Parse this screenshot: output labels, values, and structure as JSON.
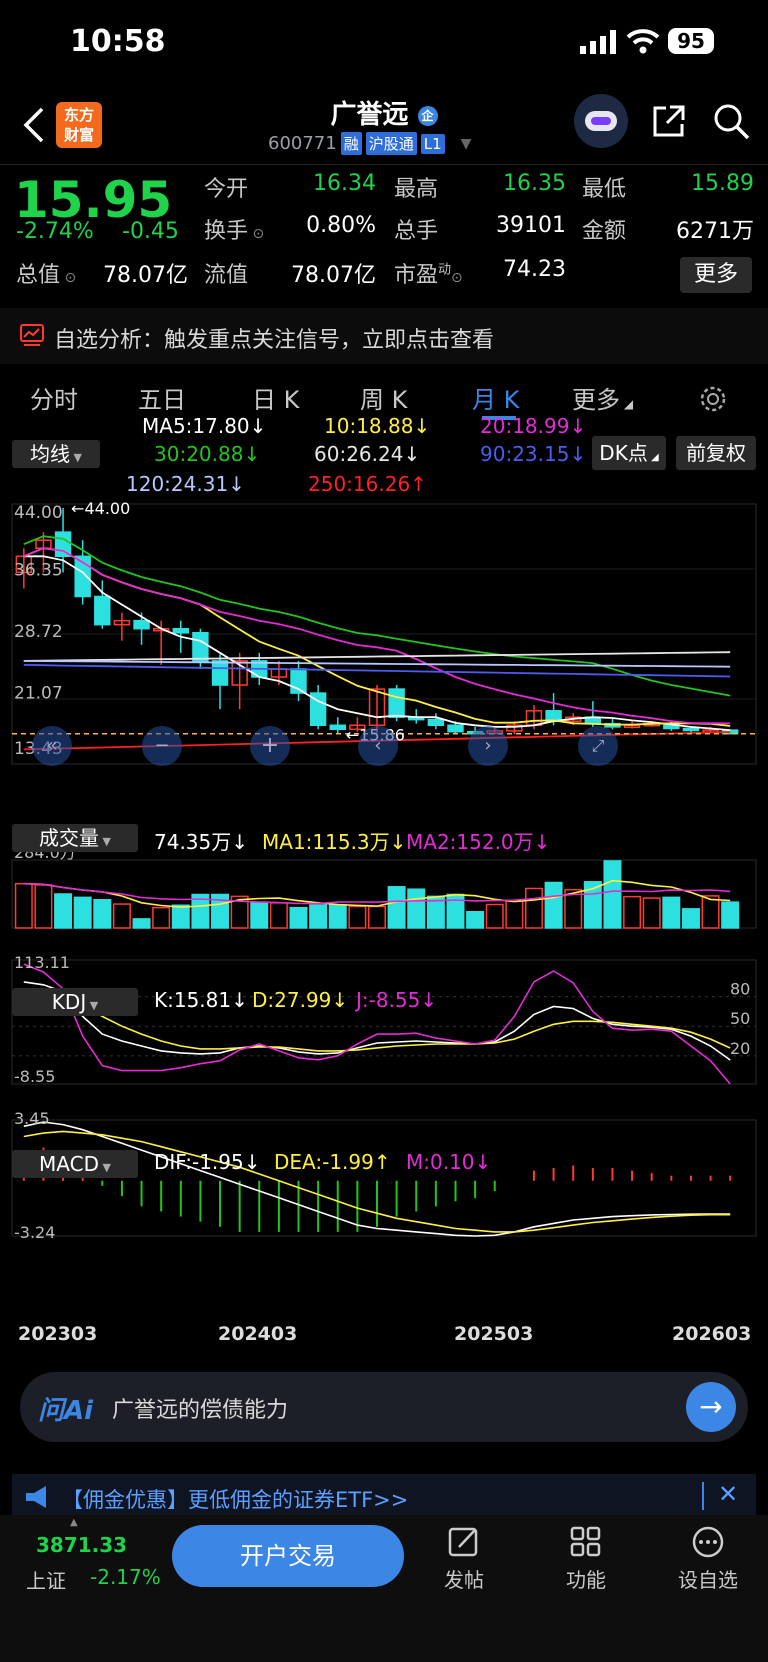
{
  "status_bar": {
    "time": "10:58",
    "battery": "95"
  },
  "header": {
    "title": "广誉远",
    "title_badge": "企",
    "logo_line1": "东方",
    "logo_line2": "财富",
    "code": "600771",
    "tags": [
      "融",
      "沪股通",
      "L1"
    ]
  },
  "quote": {
    "price": "15.95",
    "change_pct": "-2.74%",
    "change": "-0.45",
    "fields": [
      {
        "label": "今开",
        "value": "16.34",
        "color": "#1fd34a"
      },
      {
        "label": "最高",
        "value": "16.35",
        "color": "#1fd34a"
      },
      {
        "label": "最低",
        "value": "15.89",
        "color": "#1fd34a"
      },
      {
        "label": "换手",
        "value": "0.80%",
        "color": "#ffffff"
      },
      {
        "label": "总手",
        "value": "39101",
        "color": "#ffffff"
      },
      {
        "label": "金额",
        "value": "6271万",
        "color": "#ffffff"
      },
      {
        "label": "流值",
        "value": "78.07亿",
        "color": "#ffffff"
      },
      {
        "label": "市盈",
        "value": "74.23",
        "color": "#ffffff"
      }
    ],
    "total_value_label": "总值",
    "total_value": "78.07亿",
    "pe_sup": "动",
    "more_label": "更多"
  },
  "alert": {
    "text": "自选分析：触发重点关注信号，立即点击查看"
  },
  "tabs": {
    "items": [
      "分时",
      "五日",
      "日 K",
      "周 K",
      "月 K",
      "更多"
    ],
    "active": "月 K"
  },
  "chart_controls": {
    "ma_select": "均线",
    "dk_label": "DK点",
    "fq_label": "前复权",
    "vol_select": "成交量",
    "kdj_select": "KDJ",
    "macd_select": "MACD"
  },
  "colors": {
    "up": "#ff3b30",
    "down": "#2de0e0",
    "ma5": "#ffffff",
    "ma10": "#ffef3f",
    "ma20": "#e52bd6",
    "ma30": "#23c41d",
    "ma60": "#e6e6e6",
    "ma90": "#4b5cf0",
    "ma120": "#b7c7ff",
    "ma250": "#ff2020",
    "accent": "#3c86e6"
  },
  "ma_legend": [
    {
      "text": "MA5:17.80",
      "arrow": "↓",
      "color": "#ffffff"
    },
    {
      "text": "10:18.88",
      "arrow": "↓",
      "color": "#ffef3f"
    },
    {
      "text": "20:18.99",
      "arrow": "↓",
      "color": "#e52bd6"
    },
    {
      "text": "30:20.88",
      "arrow": "↓",
      "color": "#23c41d"
    },
    {
      "text": "60:26.24",
      "arrow": "↓",
      "color": "#e6e6e6"
    },
    {
      "text": "90:23.15",
      "arrow": "↓",
      "color": "#4b5cf0"
    },
    {
      "text": "120:24.31",
      "arrow": "↓",
      "color": "#b7c7ff"
    },
    {
      "text": "250:16.26",
      "arrow": "↑",
      "color": "#ff2020"
    }
  ],
  "vol_legend": [
    {
      "text": "74.35万",
      "arrow": "↓",
      "color": "#ffffff"
    },
    {
      "text": "MA1:115.3万",
      "arrow": "↓",
      "color": "#ffef3f"
    },
    {
      "text": "MA2:152.0万",
      "arrow": "↓",
      "color": "#e52bd6"
    }
  ],
  "kdj_legend": [
    {
      "text": "K:15.81",
      "arrow": "↓",
      "color": "#ffffff"
    },
    {
      "text": "D:27.99",
      "arrow": "↓",
      "color": "#ffef3f"
    },
    {
      "text": "J:-8.55",
      "arrow": "↓",
      "color": "#e52bd6"
    }
  ],
  "macd_legend": [
    {
      "text": "DIF:-1.95",
      "arrow": "↓",
      "color": "#ffffff"
    },
    {
      "text": "DEA:-1.99",
      "arrow": "↑",
      "color": "#ffef3f"
    },
    {
      "text": "M:0.10",
      "arrow": "↓",
      "color": "#e52bd6"
    }
  ],
  "chart_data": {
    "type": "candlestick",
    "price_axis": [
      "44.00",
      "36.35",
      "28.72",
      "21.07",
      "13.43"
    ],
    "ylim": [
      13.43,
      44.0
    ],
    "max_marker": "44.00",
    "min_marker": "15.86",
    "vol_axis_top": "284.0万",
    "vol_max": 284.0,
    "kdj_axis": {
      "top": "113.11",
      "bottom": "-8.55",
      "levels": [
        "80",
        "50",
        "20"
      ]
    },
    "kdj_range": [
      -8.55,
      113.11
    ],
    "macd_axis": {
      "top": "3.45",
      "bottom": "-3.24"
    },
    "macd_range": [
      -3.24,
      3.45
    ],
    "x_labels": [
      "202303",
      "202403",
      "202503",
      "202603"
    ],
    "candles": [
      [
        36,
        38,
        39,
        34
      ],
      [
        39,
        40,
        41,
        36
      ],
      [
        41,
        38,
        44,
        36
      ],
      [
        38,
        33,
        40,
        32
      ],
      [
        33,
        29.5,
        35,
        29
      ],
      [
        29.5,
        30,
        31,
        27.5
      ],
      [
        30,
        29,
        31,
        27
      ],
      [
        29,
        29,
        30,
        24.5
      ],
      [
        29,
        28.5,
        30,
        26
      ],
      [
        28.5,
        25,
        29,
        24
      ],
      [
        25,
        22,
        26,
        19
      ],
      [
        22,
        25,
        26,
        19
      ],
      [
        25,
        23,
        26,
        22
      ],
      [
        23,
        24,
        25,
        22
      ],
      [
        24,
        21,
        25,
        20
      ],
      [
        21,
        17,
        22,
        16.5
      ],
      [
        17,
        16.5,
        18,
        16
      ],
      [
        16.5,
        17,
        18,
        16.2
      ],
      [
        17,
        21.5,
        22,
        16
      ],
      [
        21.5,
        18,
        22,
        17.5
      ],
      [
        18,
        17.7,
        19,
        17.2
      ],
      [
        17.7,
        17,
        18.5,
        16.5
      ],
      [
        17,
        16.2,
        17.5,
        15.9
      ],
      [
        16.2,
        16,
        16.8,
        15.9
      ],
      [
        16,
        16.3,
        16.8,
        15.86
      ],
      [
        16.3,
        17,
        17.5,
        15.9
      ],
      [
        17,
        18.8,
        19.5,
        16.5
      ],
      [
        18.8,
        17.5,
        21,
        17
      ],
      [
        17.5,
        18,
        18.5,
        17
      ],
      [
        18,
        17.2,
        20,
        16.8
      ],
      [
        17.2,
        16.8,
        17.8,
        16.5
      ],
      [
        16.8,
        17,
        17.5,
        16.6
      ],
      [
        17,
        17.2,
        17.5,
        16.8
      ],
      [
        17.2,
        16.6,
        17.5,
        16.3
      ],
      [
        16.6,
        16.4,
        16.9,
        16.1
      ],
      [
        16.4,
        16.4,
        16.8,
        16.2
      ],
      [
        16.4,
        15.95,
        16.4,
        15.89
      ]
    ],
    "volume": [
      185,
      180,
      142,
      128,
      118,
      100,
      38,
      85,
      95,
      140,
      140,
      132,
      108,
      105,
      85,
      96,
      96,
      90,
      90,
      172,
      162,
      132,
      140,
      68,
      98,
      113,
      165,
      190,
      160,
      193,
      280,
      131,
      125,
      128,
      80,
      134,
      108
    ],
    "ma5_close": [
      38,
      38,
      37.5,
      36,
      33.5,
      32,
      30.5,
      29,
      28,
      27.5,
      26,
      24.5,
      23,
      22.5,
      21.5,
      20,
      19,
      18.5,
      18,
      18.2,
      18,
      18,
      17.3,
      17,
      16.8,
      16.8,
      17,
      17.5,
      17.8,
      18,
      17.9,
      17.6,
      17.4,
      17.1,
      16.8,
      16.6,
      16.4
    ],
    "kdj_k": [
      95,
      92,
      85,
      60,
      42,
      35,
      30,
      25,
      23,
      22,
      23,
      28,
      30,
      28,
      24,
      22,
      23,
      28,
      33,
      34,
      35,
      34,
      33,
      32,
      34,
      45,
      62,
      70,
      68,
      58,
      52,
      50,
      49,
      47,
      40,
      30,
      15.81
    ],
    "kdj_d": [
      80,
      85,
      84,
      72,
      60,
      50,
      42,
      35,
      30,
      27,
      27,
      28,
      29,
      29,
      27,
      25,
      25,
      26,
      28,
      30,
      31,
      32,
      32,
      32,
      33,
      37,
      45,
      52,
      55,
      55,
      54,
      52,
      50,
      48,
      44,
      37,
      27.99
    ],
    "kdj_j": [
      113,
      105,
      88,
      40,
      10,
      5,
      5,
      5,
      8,
      12,
      15,
      26,
      32,
      25,
      18,
      16,
      20,
      32,
      42,
      42,
      43,
      38,
      35,
      32,
      36,
      60,
      95,
      106,
      94,
      65,
      48,
      46,
      47,
      45,
      30,
      15,
      -8.55
    ],
    "macd_dif": [
      3.2,
      3.45,
      3.3,
      3.0,
      2.6,
      2.2,
      1.8,
      1.4,
      1.0,
      0.6,
      0.2,
      -0.2,
      -0.6,
      -1.0,
      -1.4,
      -1.8,
      -2.2,
      -2.6,
      -2.8,
      -2.9,
      -3.0,
      -3.1,
      -3.2,
      -3.24,
      -3.2,
      -3.0,
      -2.7,
      -2.5,
      -2.3,
      -2.2,
      -2.1,
      -2.05,
      -2.0,
      -1.98,
      -1.96,
      -1.95,
      -1.95
    ],
    "macd_dea": [
      2.6,
      2.8,
      2.9,
      2.8,
      2.7,
      2.5,
      2.3,
      2.0,
      1.7,
      1.4,
      1.1,
      0.8,
      0.4,
      0.0,
      -0.4,
      -0.8,
      -1.2,
      -1.6,
      -1.9,
      -2.2,
      -2.4,
      -2.6,
      -2.8,
      -2.9,
      -3.0,
      -3.0,
      -2.9,
      -2.75,
      -2.6,
      -2.45,
      -2.35,
      -2.25,
      -2.15,
      -2.08,
      -2.02,
      -1.99,
      -1.99
    ],
    "macd_m": [
      0.6,
      0.65,
      0.4,
      0.2,
      -0.1,
      -0.3,
      -0.5,
      -0.6,
      -0.7,
      -0.8,
      -0.9,
      -1.0,
      -1.0,
      -1.0,
      -1.0,
      -1.0,
      -1.0,
      -1.0,
      -0.9,
      -0.7,
      -0.6,
      -0.5,
      -0.4,
      -0.34,
      -0.2,
      0.0,
      0.2,
      0.25,
      0.3,
      0.25,
      0.25,
      0.2,
      0.15,
      0.1,
      0.1,
      0.1,
      0.1
    ]
  },
  "ai_search": {
    "brand": "问Ai",
    "query": "广誉远的偿债能力"
  },
  "promo": {
    "text": "【佣金优惠】更低佣金的证券ETF>>"
  },
  "bottom_bar": {
    "index_value": "3871.33",
    "index_name": "上证",
    "index_change": "-2.17%",
    "open_btn": "开户交易",
    "nav": [
      "发帖",
      "功能",
      "设自选"
    ]
  }
}
